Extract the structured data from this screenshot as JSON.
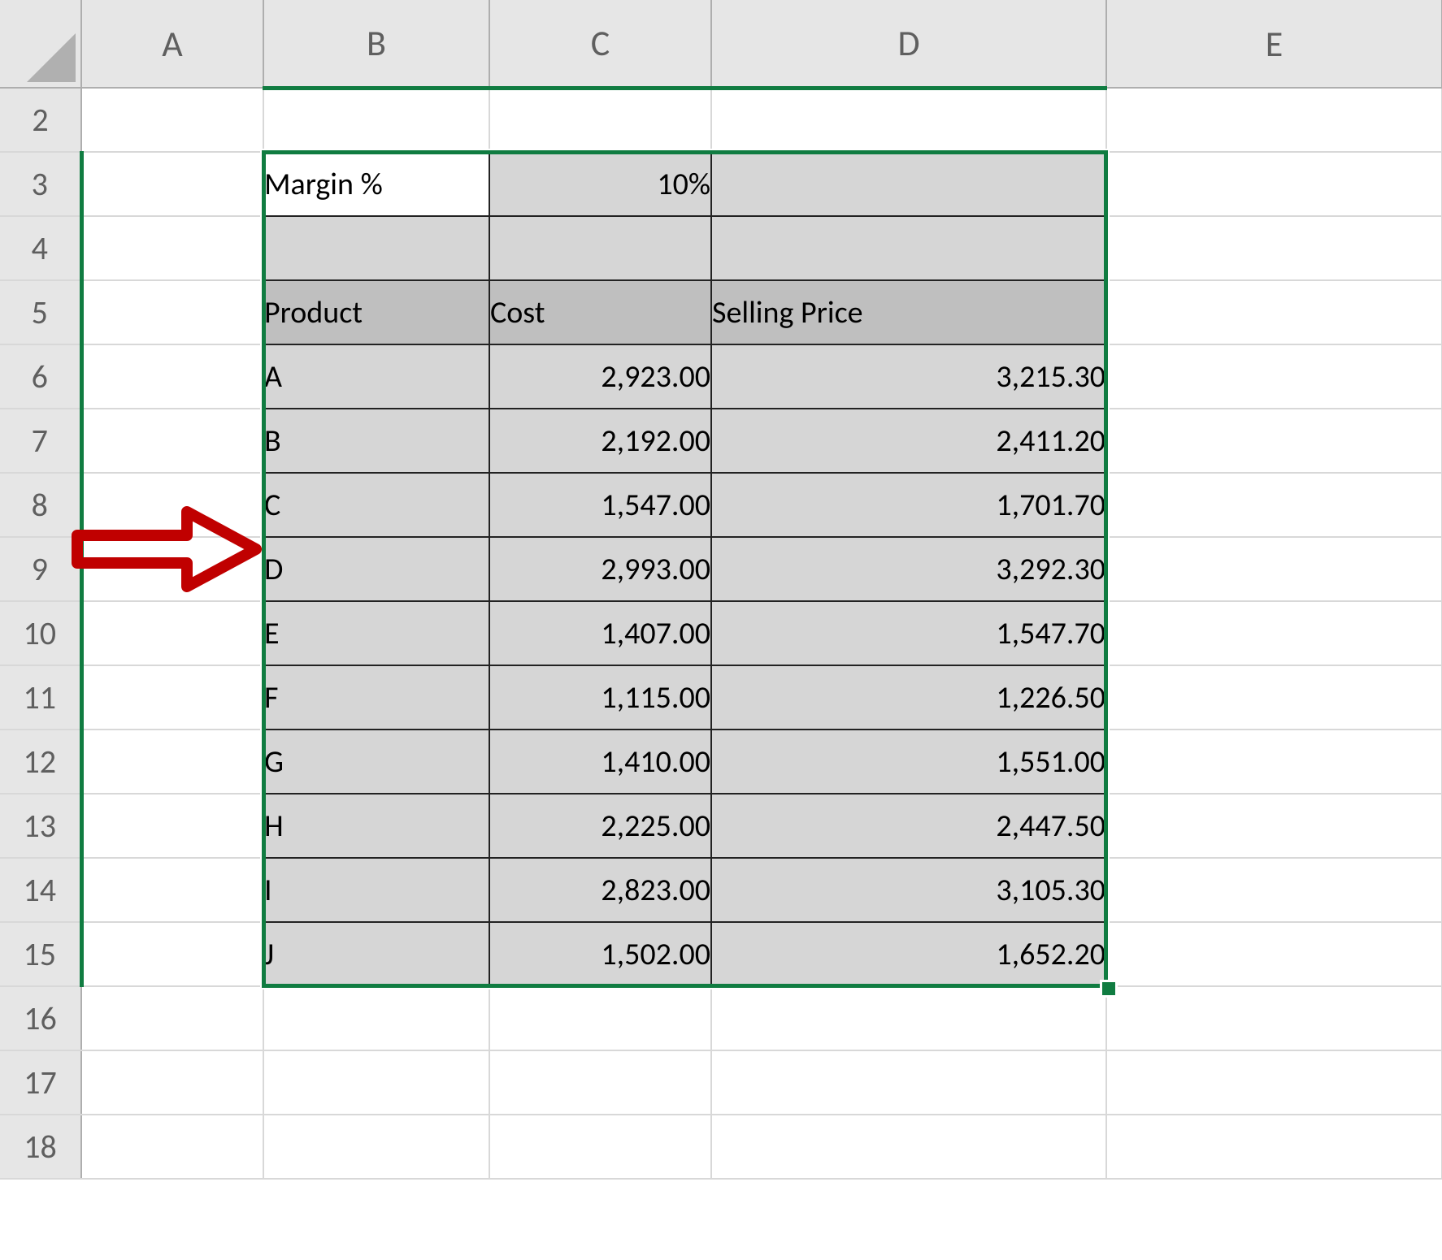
{
  "columns": {
    "A": "A",
    "B": "B",
    "C": "C",
    "D": "D",
    "E": "E"
  },
  "visible_row_headers": [
    "2",
    "3",
    "4",
    "5",
    "6",
    "7",
    "8",
    "9",
    "10",
    "11",
    "12",
    "13",
    "14",
    "15",
    "16",
    "17",
    "18"
  ],
  "margin": {
    "label": "Margin %",
    "value": "10%"
  },
  "table": {
    "headers": {
      "product": "Product",
      "cost": "Cost",
      "selling": "Selling Price"
    },
    "rows": [
      {
        "product": "A",
        "cost": "2,923.00",
        "selling": "3,215.30"
      },
      {
        "product": "B",
        "cost": "2,192.00",
        "selling": "2,411.20"
      },
      {
        "product": "C",
        "cost": "1,547.00",
        "selling": "1,701.70"
      },
      {
        "product": "D",
        "cost": "2,993.00",
        "selling": "3,292.30"
      },
      {
        "product": "E",
        "cost": "1,407.00",
        "selling": "1,547.70"
      },
      {
        "product": "F",
        "cost": "1,115.00",
        "selling": "1,226.50"
      },
      {
        "product": "G",
        "cost": "1,410.00",
        "selling": "1,551.00"
      },
      {
        "product": "H",
        "cost": "2,225.00",
        "selling": "2,447.50"
      },
      {
        "product": "I",
        "cost": "2,823.00",
        "selling": "3,105.30"
      },
      {
        "product": "J",
        "cost": "1,502.00",
        "selling": "1,652.20"
      }
    ]
  },
  "selection": {
    "range": "B3:D15",
    "active_cell": "B3"
  },
  "annotation": {
    "arrow_points_to_row": 9
  },
  "colors": {
    "selection_border": "#107c41",
    "header_fill": "#bfbfbf",
    "shaded_fill": "#d6d6d6",
    "arrow": "#c00000"
  }
}
